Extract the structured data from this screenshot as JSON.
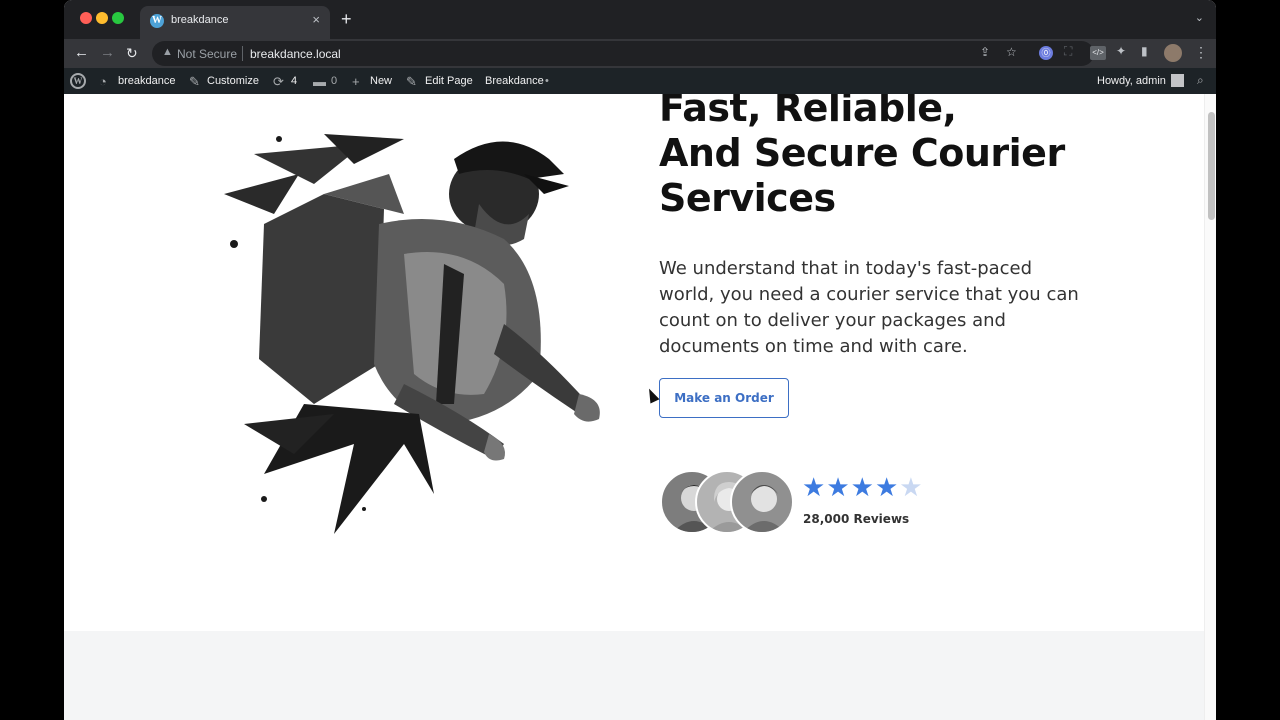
{
  "browser": {
    "tab_title": "breakdance",
    "tab_favicon": "W",
    "tab_close": "×",
    "new_tab": "+",
    "not_secure": "Not Secure",
    "url": "breakdance.local",
    "icons": [
      "back-icon",
      "forward-icon",
      "reload-icon",
      "warning-icon",
      "share-icon",
      "star-icon",
      "extension-icon",
      "sidebar-icon",
      "profile-avatar",
      "menu-icon"
    ]
  },
  "adminbar": {
    "site_name": "breakdance",
    "customize": "Customize",
    "updates_count": "4",
    "comments_count": "0",
    "new": "New",
    "edit_page": "Edit Page",
    "breakdance": "Breakdance",
    "breakdance_dot": "•",
    "howdy": "Howdy, admin"
  },
  "hero": {
    "headline_line1": "Fast, Reliable,",
    "headline_line2": "And Secure Courier",
    "headline_line3": "Services",
    "lead": "We understand that in today's fast-paced world, you need a courier service that you can count on to deliver your packages and documents on time and with care.",
    "cta_label": "Make an Order",
    "rating": 4.5,
    "reviews_label": "28,000 Reviews",
    "star_color": "#3d7be0",
    "cta_color": "#3d6fc4"
  }
}
